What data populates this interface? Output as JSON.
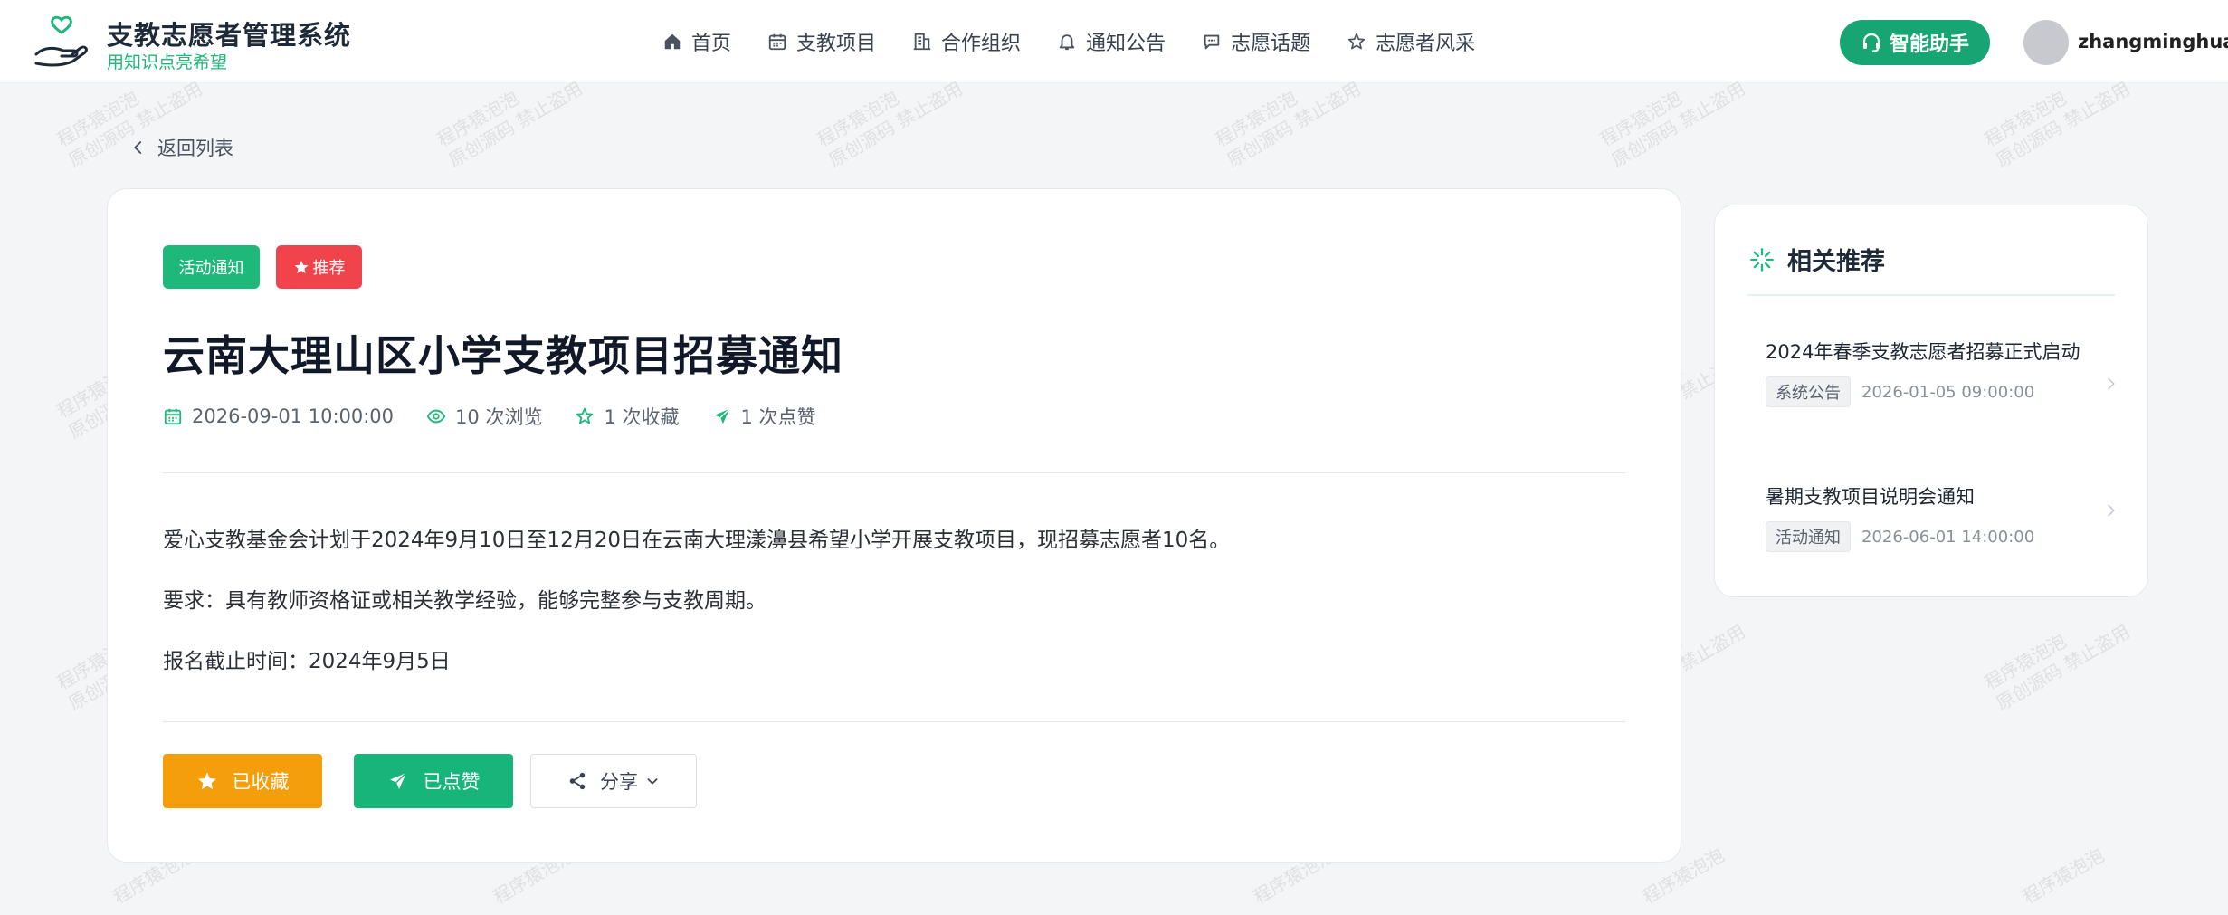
{
  "header": {
    "brand_title": "支教志愿者管理系统",
    "brand_subtitle": "用知识点亮希望",
    "nav": [
      {
        "label": "首页",
        "icon": "home-icon"
      },
      {
        "label": "支教项目",
        "icon": "calendar-icon"
      },
      {
        "label": "合作组织",
        "icon": "building-icon"
      },
      {
        "label": "通知公告",
        "icon": "bell-icon"
      },
      {
        "label": "志愿话题",
        "icon": "chat-icon"
      },
      {
        "label": "志愿者风采",
        "icon": "star-icon"
      }
    ],
    "assistant_label": "智能助手",
    "username": "zhangminghua"
  },
  "back_label": "返回列表",
  "article": {
    "tag_category": "活动通知",
    "tag_recommend": "推荐",
    "title": "云南大理山区小学支教项目招募通知",
    "date": "2026-09-01 10:00:00",
    "views": "10 次浏览",
    "favorites": "1 次收藏",
    "likes": "1 次点赞",
    "paragraphs": [
      "爱心支教基金会计划于2024年9月10日至12月20日在云南大理漾濞县希望小学开展支教项目，现招募志愿者10名。",
      "要求：具有教师资格证或相关教学经验，能够完整参与支教周期。",
      "报名截止时间：2024年9月5日"
    ],
    "btn_favorited": "已收藏",
    "btn_liked": "已点赞",
    "btn_share": "分享"
  },
  "related": {
    "title": "相关推荐",
    "items": [
      {
        "title": "2024年春季支教志愿者招募正式启动",
        "tag": "系统公告",
        "date": "2026-01-05 09:00:00"
      },
      {
        "title": "暑期支教项目说明会通知",
        "tag": "活动通知",
        "date": "2026-06-01 14:00:00"
      }
    ]
  },
  "watermark": {
    "line1": "程序猿泡泡",
    "line2": "原创源码 禁止盗用"
  },
  "colors": {
    "brand": "#17a673",
    "danger": "#f0434c",
    "warning": "#f59e0b"
  }
}
